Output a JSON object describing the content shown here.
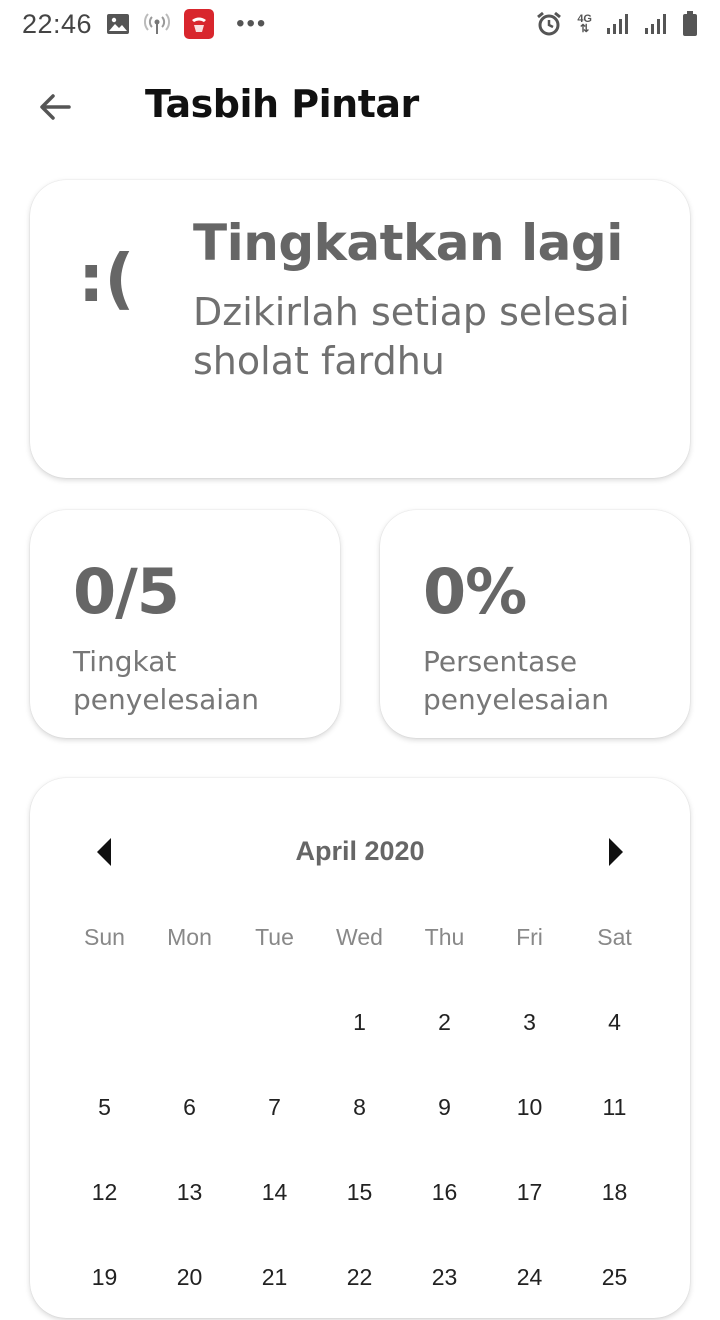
{
  "status_bar": {
    "time": "22:46",
    "network_type": "4G",
    "icons": [
      "image-icon",
      "hotspot-icon",
      "app-logo-icon",
      "more-dots-icon",
      "alarm-icon",
      "signal-icon",
      "signal-icon",
      "battery-icon"
    ]
  },
  "app_bar": {
    "back_icon": "arrow-left-icon",
    "title": "Tasbih Pintar"
  },
  "summary_card": {
    "face": ":(",
    "heading": "Tingkatkan lagi",
    "message": "Dzikirlah setiap selesai sholat fardhu"
  },
  "stats": {
    "level": {
      "value": "0/5",
      "label": "Tingkat penyelesaian"
    },
    "percent": {
      "value": "0%",
      "label": "Persentase penyelesaian"
    }
  },
  "calendar": {
    "month_label": "April 2020",
    "prev_icon": "caret-left-icon",
    "next_icon": "caret-right-icon",
    "weekdays": [
      "Sun",
      "Mon",
      "Tue",
      "Wed",
      "Thu",
      "Fri",
      "Sat"
    ],
    "days": [
      "",
      "",
      "",
      "1",
      "2",
      "3",
      "4",
      "5",
      "6",
      "7",
      "8",
      "9",
      "10",
      "11",
      "12",
      "13",
      "14",
      "15",
      "16",
      "17",
      "18",
      "19",
      "20",
      "21",
      "22",
      "23",
      "24",
      "25"
    ]
  },
  "colors": {
    "background": "#ffffff",
    "text_dark": "#111111",
    "text_muted": "#666666",
    "app_logo": "#d8262d"
  }
}
